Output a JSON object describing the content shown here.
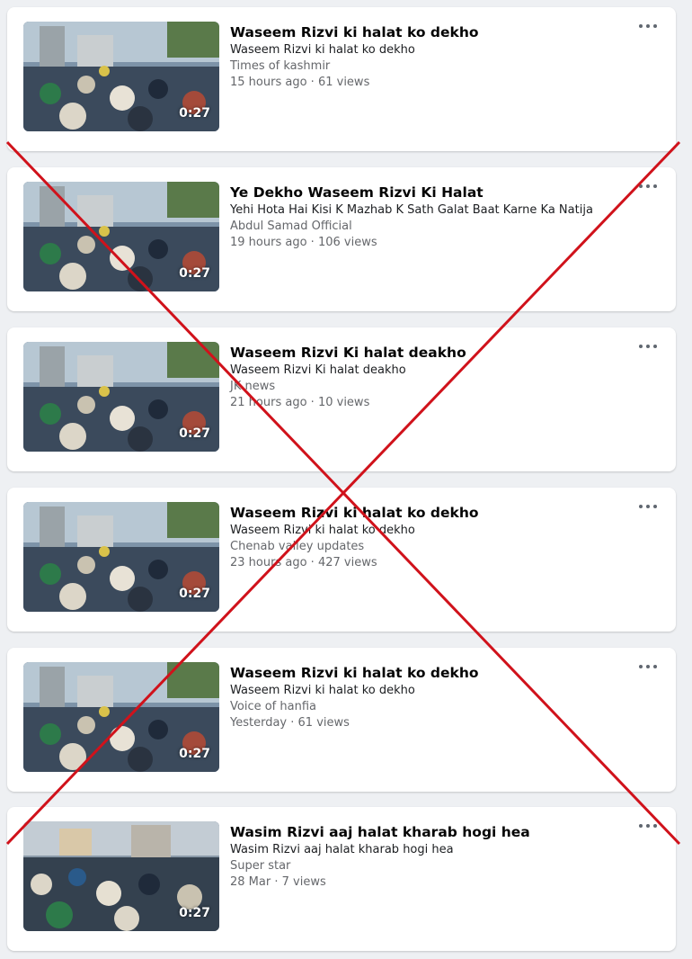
{
  "videos": [
    {
      "title": "Waseem Rizvi ki halat ko dekho",
      "subtitle": "Waseem Rizvi ki halat ko dekho",
      "channel": "Times of kashmir",
      "age": "15 hours ago",
      "separator": "·",
      "views": "61 views",
      "duration": "0:27"
    },
    {
      "title": "Ye Dekho Waseem Rizvi Ki Halat",
      "subtitle": "Yehi Hota Hai Kisi K Mazhab K Sath Galat Baat Karne Ka Natija",
      "channel": "Abdul Samad Official",
      "age": "19 hours ago",
      "separator": "·",
      "views": "106 views",
      "duration": "0:27"
    },
    {
      "title": "Waseem Rizvi Ki halat deakho",
      "subtitle": "Waseem Rizvi Ki halat deakho",
      "channel": "JK news",
      "age": "21 hours ago",
      "separator": "·",
      "views": "10 views",
      "duration": "0:27"
    },
    {
      "title": "Waseem Rizvi ki halat ko dekho",
      "subtitle": "Waseem Rizvi ki halat ko dekho",
      "channel": "Chenab valley updates",
      "age": "23 hours ago",
      "separator": "·",
      "views": "427 views",
      "duration": "0:27"
    },
    {
      "title": "Waseem Rizvi ki halat ko dekho",
      "subtitle": "Waseem Rizvi ki halat ko dekho",
      "channel": "Voice of hanfia",
      "age": "Yesterday",
      "separator": "·",
      "views": "61 views",
      "duration": "0:27"
    },
    {
      "title": "Wasim Rizvi aaj halat kharab hogi hea",
      "subtitle": "Wasim Rizvi aaj halat kharab hogi hea",
      "channel": "Super star",
      "age": "28 Mar",
      "separator": "·",
      "views": "7 views",
      "duration": "0:27"
    }
  ],
  "icons": {
    "more": "more-horizontal-icon"
  },
  "colors": {
    "cross_mark": "#d0121b",
    "card_background": "#ffffff",
    "page_background": "#eef0f3"
  }
}
